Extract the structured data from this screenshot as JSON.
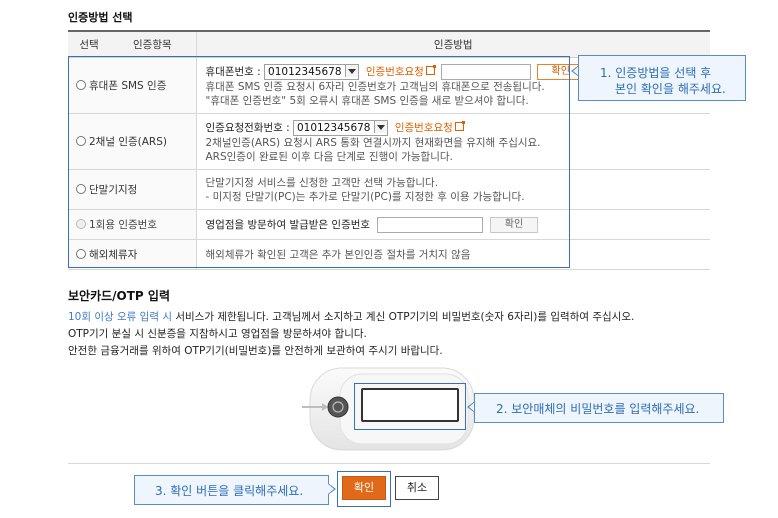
{
  "auth_section": {
    "title": "인증방법 선택",
    "headers": {
      "select": "선택",
      "item": "인증항목",
      "method": "인증방법"
    },
    "rows": [
      {
        "option": "휴대폰 SMS 인증",
        "phone_label": "휴대폰번호 :",
        "phone_value": "01012345678",
        "request_link": "인증번호요청",
        "confirm_button": "확인",
        "desc1": "휴대폰 SMS 인증 요청시 6자리 인증번호가 고객님의 휴대폰으로 전송됩니다.",
        "desc2": "\"휴대폰 인증번호\" 5회 오류시 휴대폰 SMS 인증을 새로 받으셔야 합니다."
      },
      {
        "option": "2채널 인증(ARS)",
        "phone_label": "인증요청전화번호 :",
        "phone_value": "01012345678",
        "request_link": "인증번호요청",
        "desc1": "2채널인증(ARS) 요청시 ARS 통화 연결시까지 현재화면을 유지해 주십시요.",
        "desc2": "ARS인증이 완료된 이후 다음 단계로 진행이 가능합니다."
      },
      {
        "option": "단말기지정",
        "desc1": "단말기지정 서비스를 신청한 고객만 선택 가능합니다.",
        "desc2": "- 미지정 단말기(PC)는 추가로 단말기(PC)를 지정한 후 이용 가능합니다."
      },
      {
        "option": "1회용 인증번호",
        "label": "영업점을 방문하여 발급받은 인증번호",
        "confirm_button": "확인"
      },
      {
        "option": "해외체류자",
        "desc1": "해외체류가 확인된 고객은 추가 본인인증 절차를 거치지 않음"
      }
    ]
  },
  "callout1": {
    "line1": "1. 인증방법을 선택 후",
    "line2": "본인 확인을 해주세요."
  },
  "otp_section": {
    "title": "보안카드/OTP 입력",
    "warning": "10회 이상 오류 입력 시",
    "line1_rest": " 서비스가 제한됩니다. 고객님께서 소지하고 계신 OTP기기의 비밀번호(숫자 6자리)를 입력하여 주십시오.",
    "line2": "OTP기기 분실 시 신분증을 지참하시고 영업점을 방문하셔야 합니다.",
    "line3": "안전한 금융거래를 위하여 OTP기기(비밀번호)를 안전하게 보관하여 주시기 바랍니다."
  },
  "callout2": {
    "text": "2. 보안매체의 비밀번호를 입력해주세요."
  },
  "callout3": {
    "text": "3. 확인 버튼을 클릭해주세요."
  },
  "actions": {
    "confirm": "확인",
    "cancel": "취소"
  },
  "colors": {
    "accent_orange": "#e06a1a",
    "callout_blue": "#2d6db5",
    "frame_blue": "#3b6fb6"
  }
}
